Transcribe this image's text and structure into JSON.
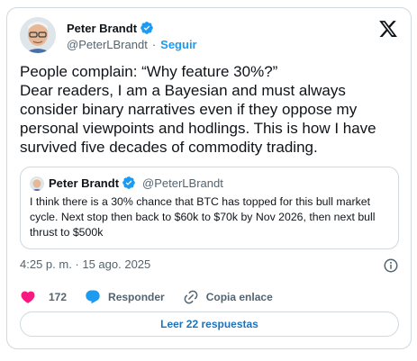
{
  "author": {
    "name": "Peter Brandt",
    "handle": "@PeterLBrandt",
    "follow_label": "Seguir",
    "separator": "·"
  },
  "tweet": {
    "text": "People complain: “Why feature 30%?”\nDear readers, I am a Bayesian and must always consider binary narratives even if they oppose my personal viewpoints and hodlings. This is how I have survived five decades of commodity trading."
  },
  "quote": {
    "name": "Peter Brandt",
    "handle": "@PeterLBrandt",
    "text": "I think there is a 30% chance that BTC has topped for this bull market cycle. Next stop then back to $60k to $70k by Nov 2026, then next bull thrust to $500k"
  },
  "meta": {
    "timestamp": "4:25 p. m. · 15 ago. 2025"
  },
  "actions": {
    "like_count": "172",
    "reply_label": "Responder",
    "copy_link_label": "Copia enlace"
  },
  "footer": {
    "read_replies_label": "Leer 22 respuestas"
  },
  "colors": {
    "accent": "#1d9bf0",
    "like": "#f91880",
    "muted": "#536471",
    "border": "#cfd9de"
  },
  "icons": [
    "verified-badge-icon",
    "x-logo-icon",
    "info-icon",
    "heart-icon",
    "reply-bubble-icon",
    "link-icon"
  ]
}
